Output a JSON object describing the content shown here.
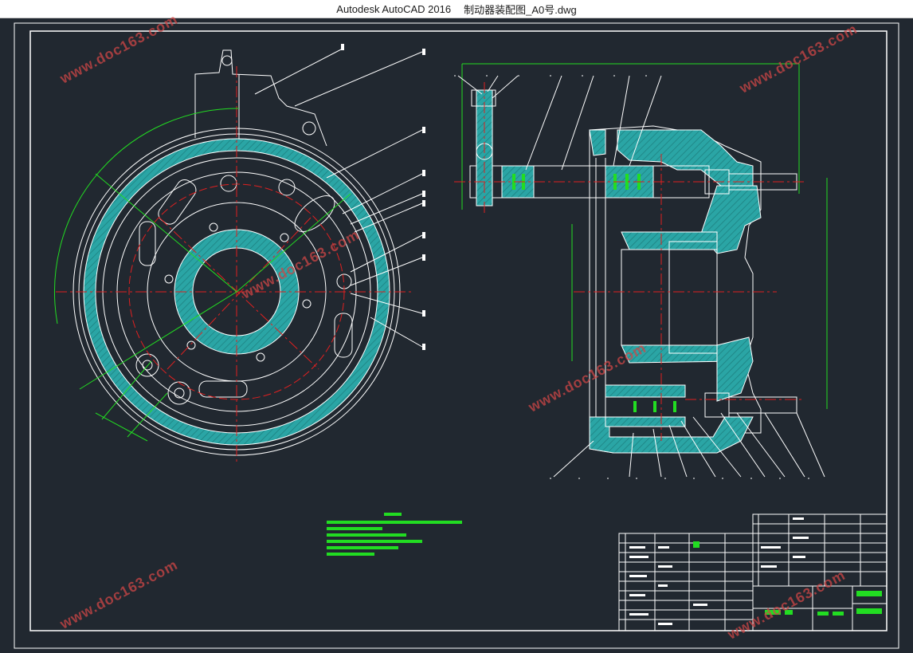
{
  "window": {
    "app_name": "Autodesk AutoCAD 2016",
    "file_name": "制动器装配图_A0号.dwg"
  },
  "watermark": {
    "text": "www.doc163.com",
    "color": "#cd4646"
  },
  "drawing": {
    "background": "#212830",
    "line_color": "#ffffff",
    "hatch_color": "#2aa5a5",
    "center_line_color": "#e02020",
    "dimension_color": "#22dd22"
  }
}
